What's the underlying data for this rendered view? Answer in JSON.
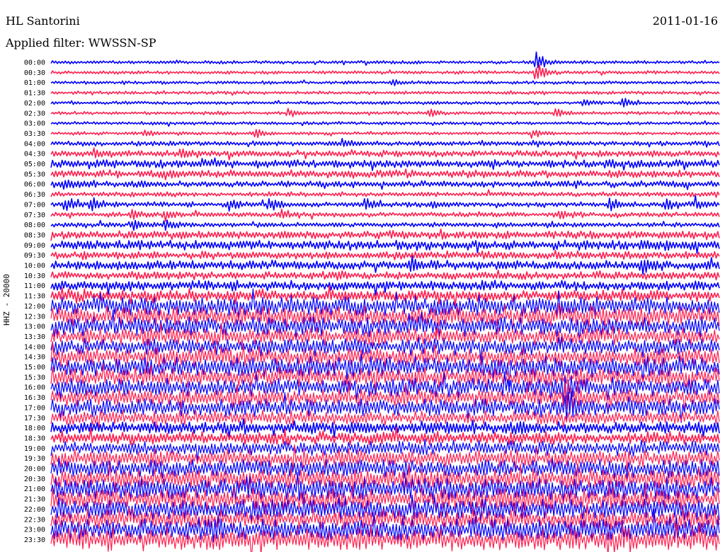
{
  "header": {
    "station": "HL Santorini",
    "date": "2011-01-16",
    "filter": "Applied filter: WWSSN-SP"
  },
  "chart_data": {
    "type": "line",
    "title": "HL Santorini",
    "subtitle": "Applied filter: WWSSN-SP",
    "date": "2011-01-16",
    "ylabel": "HHZ - 20000",
    "xlabel": "",
    "rows": [
      "00:00",
      "00:30",
      "01:00",
      "01:30",
      "02:00",
      "02:30",
      "03:00",
      "03:30",
      "04:00",
      "04:30",
      "05:00",
      "05:30",
      "06:00",
      "06:30",
      "07:00",
      "07:30",
      "08:00",
      "08:30",
      "09:00",
      "09:30",
      "10:00",
      "10:30",
      "11:00",
      "11:30",
      "12:00",
      "12:30",
      "13:00",
      "13:30",
      "14:00",
      "14:30",
      "15:00",
      "15:30",
      "16:00",
      "16:30",
      "17:00",
      "17:30",
      "18:00",
      "18:30",
      "19:00",
      "19:30",
      "20:00",
      "20:30",
      "21:00",
      "21:30",
      "22:00",
      "22:30",
      "23:00",
      "23:30"
    ],
    "row_colors": [
      "#0000ff",
      "#ff1f4f"
    ],
    "noise_level": [
      2,
      2,
      2,
      2,
      2,
      2,
      2,
      2,
      3,
      4,
      5,
      5,
      4,
      3,
      3,
      3,
      3,
      5,
      6,
      5,
      6,
      5,
      6,
      7,
      12,
      13,
      12,
      11,
      11,
      12,
      13,
      12,
      12,
      11,
      11,
      9,
      8,
      8,
      9,
      11,
      12,
      13,
      14,
      14,
      14,
      13,
      14,
      14
    ],
    "events": [
      {
        "row": "00:00",
        "x": 0.725,
        "amp": 14
      },
      {
        "row": "00:30",
        "x": 0.725,
        "amp": 18
      },
      {
        "row": "01:00",
        "x": 0.51,
        "amp": 4
      },
      {
        "row": "02:00",
        "x": 0.855,
        "amp": 8
      },
      {
        "row": "02:00",
        "x": 0.795,
        "amp": 5
      },
      {
        "row": "02:30",
        "x": 0.355,
        "amp": 8
      },
      {
        "row": "02:30",
        "x": 0.565,
        "amp": 8
      },
      {
        "row": "02:30",
        "x": 0.755,
        "amp": 7
      },
      {
        "row": "03:30",
        "x": 0.14,
        "amp": 7
      },
      {
        "row": "03:30",
        "x": 0.305,
        "amp": 6
      },
      {
        "row": "03:30",
        "x": 0.72,
        "amp": 7
      },
      {
        "row": "04:00",
        "x": 0.435,
        "amp": 7
      },
      {
        "row": "04:30",
        "x": 0.065,
        "amp": 8
      },
      {
        "row": "04:30",
        "x": 0.195,
        "amp": 7
      },
      {
        "row": "06:00",
        "x": 0.02,
        "amp": 7
      },
      {
        "row": "07:00",
        "x": 0.02,
        "amp": 9
      },
      {
        "row": "07:00",
        "x": 0.06,
        "amp": 10
      },
      {
        "row": "07:00",
        "x": 0.265,
        "amp": 9
      },
      {
        "row": "07:00",
        "x": 0.325,
        "amp": 10
      },
      {
        "row": "07:00",
        "x": 0.47,
        "amp": 10
      },
      {
        "row": "07:00",
        "x": 0.57,
        "amp": 8
      },
      {
        "row": "07:00",
        "x": 0.835,
        "amp": 10
      },
      {
        "row": "07:00",
        "x": 0.92,
        "amp": 11
      },
      {
        "row": "07:00",
        "x": 0.965,
        "amp": 9
      },
      {
        "row": "07:30",
        "x": 0.12,
        "amp": 8
      },
      {
        "row": "07:30",
        "x": 0.17,
        "amp": 8
      },
      {
        "row": "07:30",
        "x": 0.345,
        "amp": 8
      },
      {
        "row": "07:30",
        "x": 0.76,
        "amp": 7
      },
      {
        "row": "08:00",
        "x": 0.12,
        "amp": 9
      },
      {
        "row": "08:00",
        "x": 0.17,
        "amp": 8
      },
      {
        "row": "10:00",
        "x": 0.54,
        "amp": 9
      },
      {
        "row": "10:00",
        "x": 0.885,
        "amp": 8
      },
      {
        "row": "16:00",
        "x": 0.765,
        "amp": 26
      },
      {
        "row": "16:30",
        "x": 0.77,
        "amp": 28
      },
      {
        "row": "17:00",
        "x": 0.77,
        "amp": 20
      }
    ]
  }
}
